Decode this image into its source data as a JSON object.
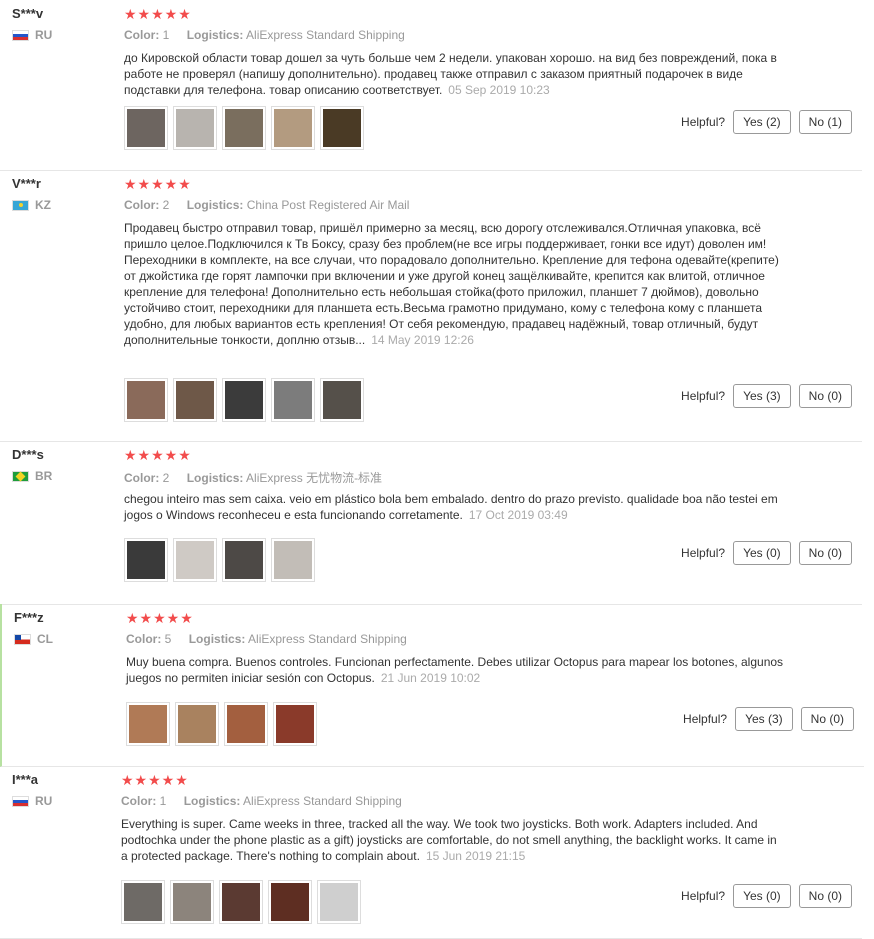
{
  "labels": {
    "color": "Color:",
    "logistics": "Logistics:",
    "helpful": "Helpful?"
  },
  "stars": "★★★★★",
  "reviews": [
    {
      "user": "S***v",
      "country": "RU",
      "color": "1",
      "logistics": "AliExpress Standard Shipping",
      "text": "до Кировской области товар дошел за чуть больше чем 2 недели. упакован хорошо. на вид без повреждений, пока в работе не проверял (напишу дополнительно). продавец также отправил с заказом приятный подарочек в виде подставки для телефона. товар описанию соответствует.",
      "date": "05 Sep 2019 10:23",
      "yes": "Yes (2)",
      "no": "No (1)",
      "thumb_colors": [
        "#6d6560",
        "#b8b4af",
        "#7a6e5e",
        "#b39b80",
        "#4a3a25"
      ]
    },
    {
      "user": "V***r",
      "country": "KZ",
      "color": "2",
      "logistics": "China Post Registered Air Mail",
      "text": "Продавец быстро отправил товар, пришёл примерно за месяц, всю дорогу отслеживался.Отличная упаковка, всё пришло целое.Подключился к Тв Боксу, сразу без проблем(не все игры поддерживает, гонки все идут) доволен им! Переходники в комплекте, на все случаи, что порадовало дополнительно. Крепление для тефона одевайте(крепите) от джойстика где горят лампочки при включении и уже другой конец защёлкивайте, крепится как влитой, отличное крепление для телефона! Дополнительно есть небольшая стойка(фото приложил, планшет 7 дюймов), довольно устойчиво стоит, переходники для планшета есть.Весьма грамотно придумано, кому с телефона кому с планшета удобно, для любых вариантов есть крепления! От себя рекомендую, прадавец надёжный, товар отличный, будут дополнительные тонкости, доплню отзыв...",
      "date": "14 May 2019 12:26",
      "yes": "Yes (3)",
      "no": "No (0)",
      "thumb_colors": [
        "#8a6a5a",
        "#6e5848",
        "#3b3b3b",
        "#7c7c7c",
        "#55504a"
      ]
    },
    {
      "user": "D***s",
      "country": "BR",
      "color": "2",
      "logistics": "AliExpress 无忧物流-标准",
      "text": "chegou inteiro mas sem caixa. veio em plástico bola bem embalado. dentro do prazo previsto. qualidade boa não testei em jogos o Windows reconheceu e esta funcionando corretamente.",
      "date": "17 Oct 2019 03:49",
      "yes": "Yes (0)",
      "no": "No (0)",
      "thumb_colors": [
        "#3a3a3a",
        "#cfcac5",
        "#4d4946",
        "#c2bdb7"
      ]
    },
    {
      "user": "F***z",
      "country": "CL",
      "color": "5",
      "logistics": "AliExpress Standard Shipping",
      "text": "Muy buena compra. Buenos controles. Funcionan perfectamente. Debes utilizar Octopus para mapear los botones, algunos juegos no permiten iniciar sesión con Octopus.",
      "date": "21 Jun 2019 10:02",
      "yes": "Yes (3)",
      "no": "No (0)",
      "thumb_colors": [
        "#b07a56",
        "#a9825f",
        "#a35f3f",
        "#8a3a2a"
      ]
    },
    {
      "user": "I***a",
      "country": "RU",
      "color": "1",
      "logistics": "AliExpress Standard Shipping",
      "text": "Everything is super. Came weeks in three, tracked all the way. We took two joysticks. Both work. Adapters included. And podtochka under the phone plastic as a gift) joysticks are comfortable, do not smell anything, the backlight works. It came in a protected package. There's nothing to complain about.",
      "date": "15 Jun 2019 21:15",
      "yes": "Yes (0)",
      "no": "No (0)",
      "thumb_colors": [
        "#6e6a66",
        "#8c847c",
        "#5b3a32",
        "#5e2e22",
        "#cfcfcf"
      ]
    }
  ]
}
